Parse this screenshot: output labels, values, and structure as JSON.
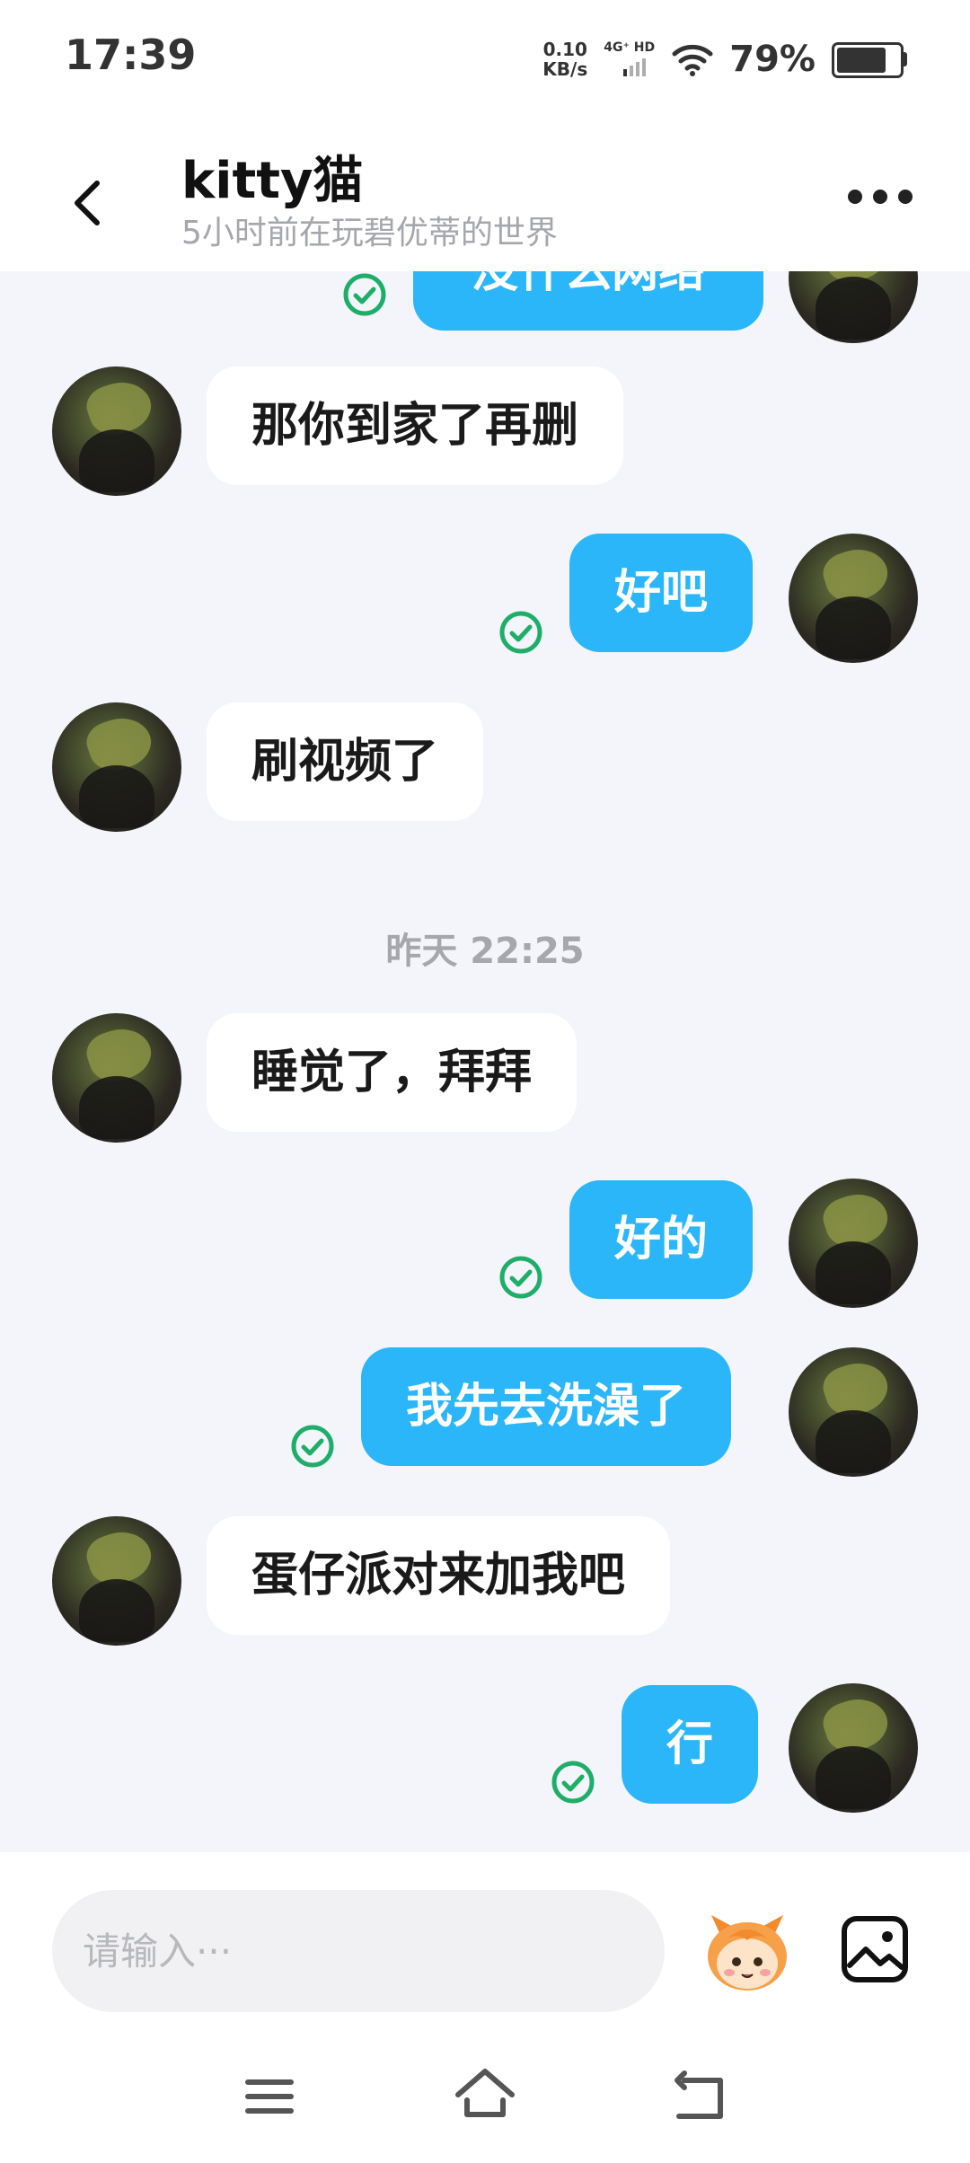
{
  "status_bar": {
    "time": "17:39",
    "speed_value": "0.10",
    "speed_unit": "KB/s",
    "network": "4G⁺ HD",
    "battery": "79%"
  },
  "header": {
    "title": "kitty猫",
    "subtitle": "5小时前在玩碧优蒂的世界"
  },
  "messages": [
    {
      "side": "out",
      "text": "没什么网络",
      "partial": true
    },
    {
      "side": "in",
      "text": "那你到家了再删"
    },
    {
      "side": "out",
      "text": "好吧"
    },
    {
      "side": "in",
      "text": "刷视频了"
    },
    {
      "side": "time",
      "text": "昨天 22:25"
    },
    {
      "side": "in",
      "text": "睡觉了，拜拜"
    },
    {
      "side": "out",
      "text": "好的"
    },
    {
      "side": "out",
      "text": "我先去洗澡了"
    },
    {
      "side": "in",
      "text": "蛋仔派对来加我吧"
    },
    {
      "side": "out",
      "text": "行"
    }
  ],
  "input": {
    "placeholder": "请输入···"
  },
  "colors": {
    "outgoing_bubble": "#2bb6f9",
    "incoming_bubble": "#ffffff",
    "read_check": "#1fae6a",
    "chat_background": "#f3f5fa"
  },
  "icons": {
    "back": "back-arrow-icon",
    "more": "more-dots-icon",
    "emoji": "emoji-character-icon",
    "image": "image-icon",
    "nav_menu": "menu-icon",
    "nav_home": "home-icon",
    "nav_back": "back-icon"
  }
}
